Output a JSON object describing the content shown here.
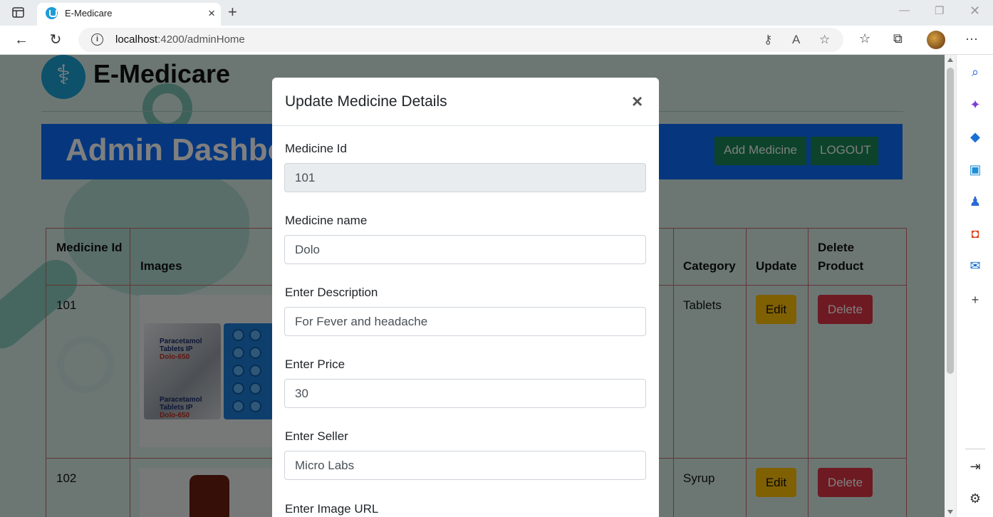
{
  "browser": {
    "tab_title": "E-Medicare",
    "url_host": "localhost",
    "url_path": ":4200/adminHome"
  },
  "page": {
    "brand": "E-Medicare",
    "banner_title": "Admin Dashboard",
    "add_medicine_label": "Add Medicine",
    "logout_label": "LOGOUT",
    "table": {
      "headers": {
        "medicine_id": "Medicine Id",
        "images": "Images",
        "category": "Category",
        "update": "Update",
        "delete_product": "Delete Product"
      },
      "rows": [
        {
          "id": "101",
          "category": "Tablets",
          "edit": "Edit",
          "delete": "Delete",
          "image_text": [
            "Paracetamol",
            "Tablets IP",
            "Dolo-650",
            "Paracetamol",
            "Tablets IP",
            "Dolo-650"
          ]
        },
        {
          "id": "102",
          "category": "Syrup",
          "edit": "Edit",
          "delete": "Delete"
        }
      ]
    }
  },
  "modal": {
    "title": "Update Medicine Details",
    "close": "×",
    "fields": [
      {
        "label": "Medicine Id",
        "value": "101"
      },
      {
        "label": "Medicine name",
        "value": "Dolo"
      },
      {
        "label": "Enter Description",
        "value": "For Fever and headache"
      },
      {
        "label": "Enter Price",
        "value": "30"
      },
      {
        "label": "Enter Seller",
        "value": "Micro Labs"
      },
      {
        "label": "Enter Image URL",
        "value": ""
      }
    ]
  },
  "colors": {
    "banner_blue": "#0d6efd",
    "success_green": "#198754",
    "warning_yellow": "#ffc107",
    "danger_red": "#dc3545"
  }
}
